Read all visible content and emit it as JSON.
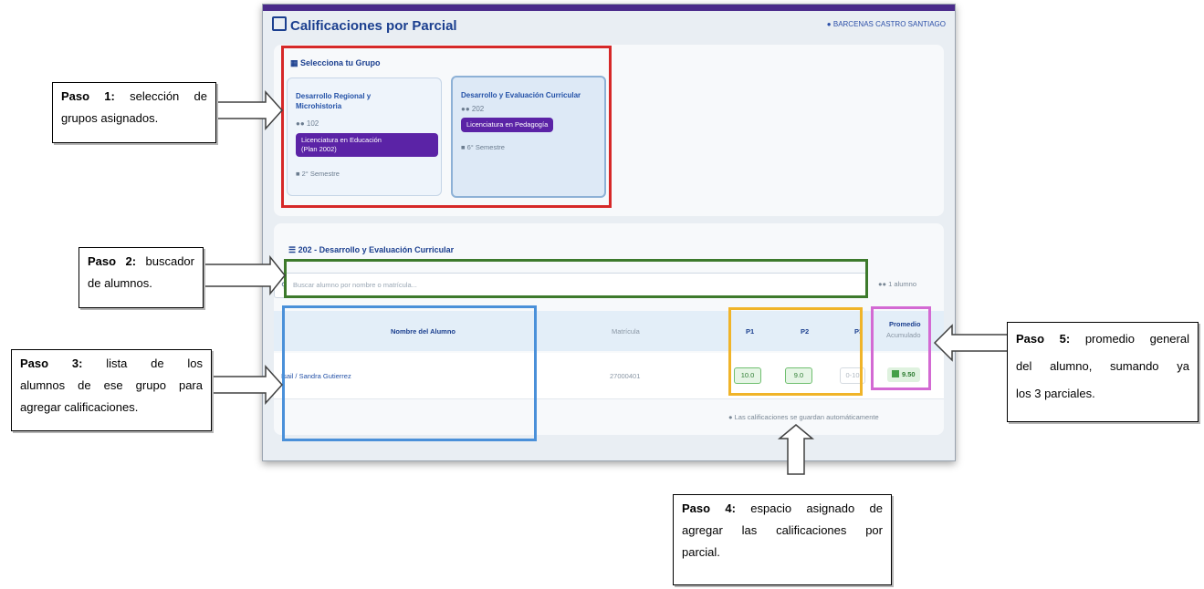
{
  "app": {
    "title": "Calificaciones por Parcial",
    "user": "BARCENAS CASTRO SANTIAGO"
  },
  "groups_section": {
    "title": "Selecciona tu Grupo",
    "groups": [
      {
        "name_line1": "Desarrollo Regional y",
        "name_line2": "Microhistoria",
        "count": "102",
        "program_line1": "Licenciatura en Educación",
        "program_line2": "(Plan 2002)",
        "semester": "2° Semestre",
        "selected": false
      },
      {
        "name_line1": "Desarrollo y Evaluación Curricular",
        "name_line2": "",
        "count": "202",
        "program_line1": "Licenciatura en Pedagogía",
        "program_line2": "",
        "semester": "6° Semestre",
        "selected": true
      }
    ]
  },
  "table_section": {
    "title": "202 - Desarrollo y Evaluación Curricular",
    "search_placeholder": "Buscar alumno por nombre o matrícula...",
    "student_count": "1 alumno",
    "headers": {
      "name": "Nombre del Alumno",
      "matricula": "Matrícula",
      "p1": "P1",
      "p2": "P2",
      "p3": "P3",
      "avg_line1": "Promedio",
      "avg_line2": "Acumulado"
    },
    "rows": [
      {
        "name": "Isail / Sandra Gutierrez",
        "matricula": "27000401",
        "p1": "10.0",
        "p2": "9.0",
        "p3_placeholder": "0-10",
        "average": "9.50"
      }
    ],
    "footnote": "Las calificaciones se guardan automáticamente"
  },
  "callouts": {
    "step1": {
      "label": "Paso 1:",
      "line1_rest": "selección de",
      "line2": "grupos asignados."
    },
    "step2": {
      "label": "Paso 2:",
      "line1_rest": "buscador",
      "line2": "de alumnos."
    },
    "step3": {
      "line1": "Paso 3: lista de los",
      "line2": "alumnos de ese grupo para",
      "line3": "agregar calificaciones."
    },
    "step4": {
      "label": "Paso 4:",
      "line1_rest": "espacio asignado de",
      "line2": "agregar las calificaciones por",
      "line3": "parcial."
    },
    "step5": {
      "label": "Paso 5:",
      "line1_rest": "promedio general",
      "line2": "del alumno, sumando ya",
      "line3": "los 3 parciales."
    }
  },
  "colors": {
    "step1_box": "#d62828",
    "step2_box": "#3d7a2c",
    "step3_box": "#4a90d9",
    "step4_box": "#f0b429",
    "step5_box": "#d36ad3",
    "accent_purple": "#5b23a6",
    "title_blue": "#1b3f8f"
  }
}
